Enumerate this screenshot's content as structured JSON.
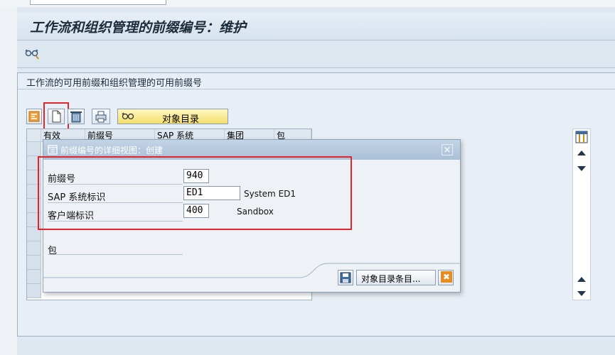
{
  "window": {
    "title": "工作流和组织管理的前缀编号：维护"
  },
  "panel": {
    "title": "工作流的可用前缀和组织管理的可用前缀号",
    "object_dir_button": "对象目录"
  },
  "table": {
    "columns": [
      "有效",
      "前缀号",
      "SAP 系统",
      "集团",
      "包"
    ]
  },
  "dialog": {
    "title": "前缀编号的详细视图：创建",
    "close_glyph": "×",
    "fields": {
      "prefix_label": "前缀号",
      "prefix_value": "940",
      "sap_label": "SAP 系统标识",
      "sap_value": "ED1",
      "sap_desc": "System ED1",
      "client_label": "客户端标识",
      "client_value": "400",
      "client_desc": "Sandbox",
      "package_label": "包"
    },
    "buttons": {
      "object_entry": "对象目录条目...",
      "cancel_glyph": "✖"
    }
  },
  "colors": {
    "highlight": "#e0262a",
    "title_text": "#1d2c3a",
    "dialog_header": "#a9c0d7",
    "yellow_button": "#fff2a0"
  },
  "icons": [
    "glasses-icon",
    "toggle-icon",
    "new-document-icon",
    "delete-icon",
    "print-icon",
    "glasses-small-icon",
    "layout-icon",
    "scroll-up-icon",
    "scroll-down-icon",
    "save-icon",
    "cancel-icon",
    "close-icon",
    "dialog-icon"
  ]
}
